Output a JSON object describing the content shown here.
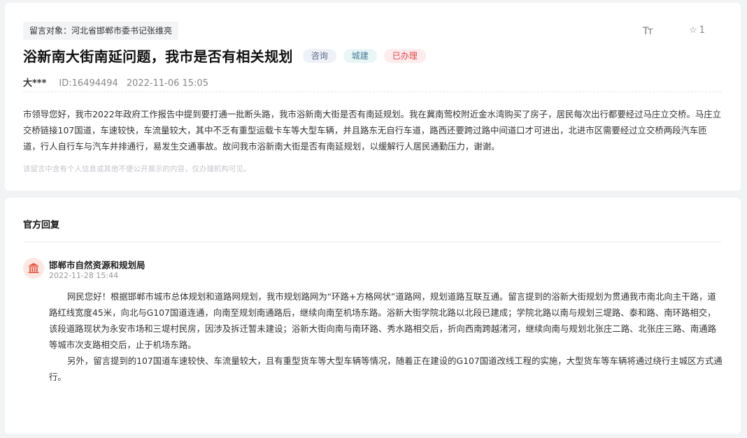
{
  "message": {
    "target_label": "留言对象：河北省邯郸市委书记张维亮",
    "font_tool_label": "Tт",
    "star_count": "1",
    "title": "浴新南大街南延问题，我市是否有相关规划",
    "tags": [
      "咨询",
      "城建",
      "已办理"
    ],
    "author": "大***",
    "id_text": "ID:16494494",
    "datetime": "2022-11-06 15:05",
    "content": "市领导您好，我市2022年政府工作报告中提到要打通一批断头路，我市浴新南大街是否有南延规划。我在冀南莺校附近金水湾购买了房子，居民每次出行都要经过马庄立交桥。马庄立交桥链接107国道，车速较快，车流量较大，其中不乏有重型运载卡车等大型车辆，并且路东无自行车道，路西还要跨过路中间道口才可进出，北进市区需要经过立交桥两段汽车匝道，行人自行车与汽车并排通行，易发生交通事故。故问我市浴新南大街是否有南延规划，以缓解行人居民通勤压力，谢谢。",
    "privacy_note": "该留言中含有个人信息或其他不便公开展示的内容，仅办理机构可见。"
  },
  "reply": {
    "section_title": "官方回复",
    "org_name": "邯郸市自然资源和规划局",
    "datetime": "2022-11-28 15:44",
    "paragraphs": [
      "网民您好！根据邯郸市城市总体规划和道路网规划，我市规划路网为“环路+方格网状”道路网，规划道路互联互通。留言提到的浴新大街规划为贯通我市南北向主干路，道路红线宽度45米，向北与G107国道连通，向南至规划南通路后，继续向南至机场东路。浴新大街学院北路以北段已建成；学院北路以南与规划三堤路、泰和路、南环路相交，该段道路现状为永安市场和三堤村民房，因涉及拆迁暂未建设；浴新大街向南与南环路、秀水路相交后，折向西南跨越渚河，继续向南与规划北张庄二路、北张庄三路、南通路等城市次支路相交后，止于机场东路。",
      "另外，留言提到的107国道车速较快、车流量较大，且有重型货车等大型车辆等情况，随着正在建设的G107国道改线工程的实施，大型货车等车辆将通过绕行主城区方式通行。"
    ]
  },
  "colors": {
    "tag_consult_bg": "#eef1f7",
    "tag_city_bg": "#e9f6f6",
    "tag_done_bg": "#fdeced",
    "tag_done_text": "#e04848",
    "avatar_bg": "#fde7e4",
    "avatar_icon": "#e5533c"
  },
  "icons": {
    "font_size": "font-size-icon",
    "favorite": "star-icon",
    "org_avatar": "government-building-icon"
  }
}
